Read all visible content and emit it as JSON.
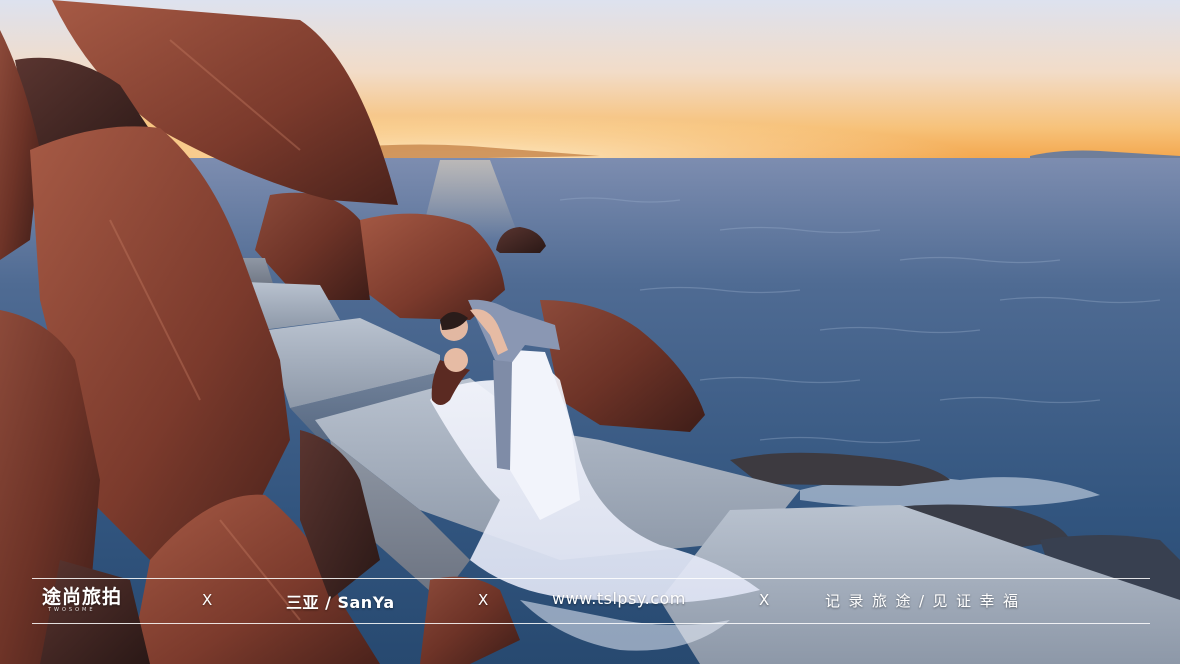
{
  "photo": {
    "subject": "wedding couple kissing on stone steps by the sea at sunset",
    "colors": {
      "sky_top": "#dfe3ee",
      "sky_horizon": "#f6b45a",
      "sea": "#3d5f86",
      "rock": "#7a3a2c",
      "dress": "#eef1fb",
      "suit": "#8796b4"
    }
  },
  "banner": {
    "logo_text": "途尚旅拍",
    "logo_sub": "TWOSOME",
    "separator": "X",
    "location": "三亚 / SanYa",
    "website": "www.tslpsy.com",
    "slogan": "记录旅途/见证幸福"
  }
}
